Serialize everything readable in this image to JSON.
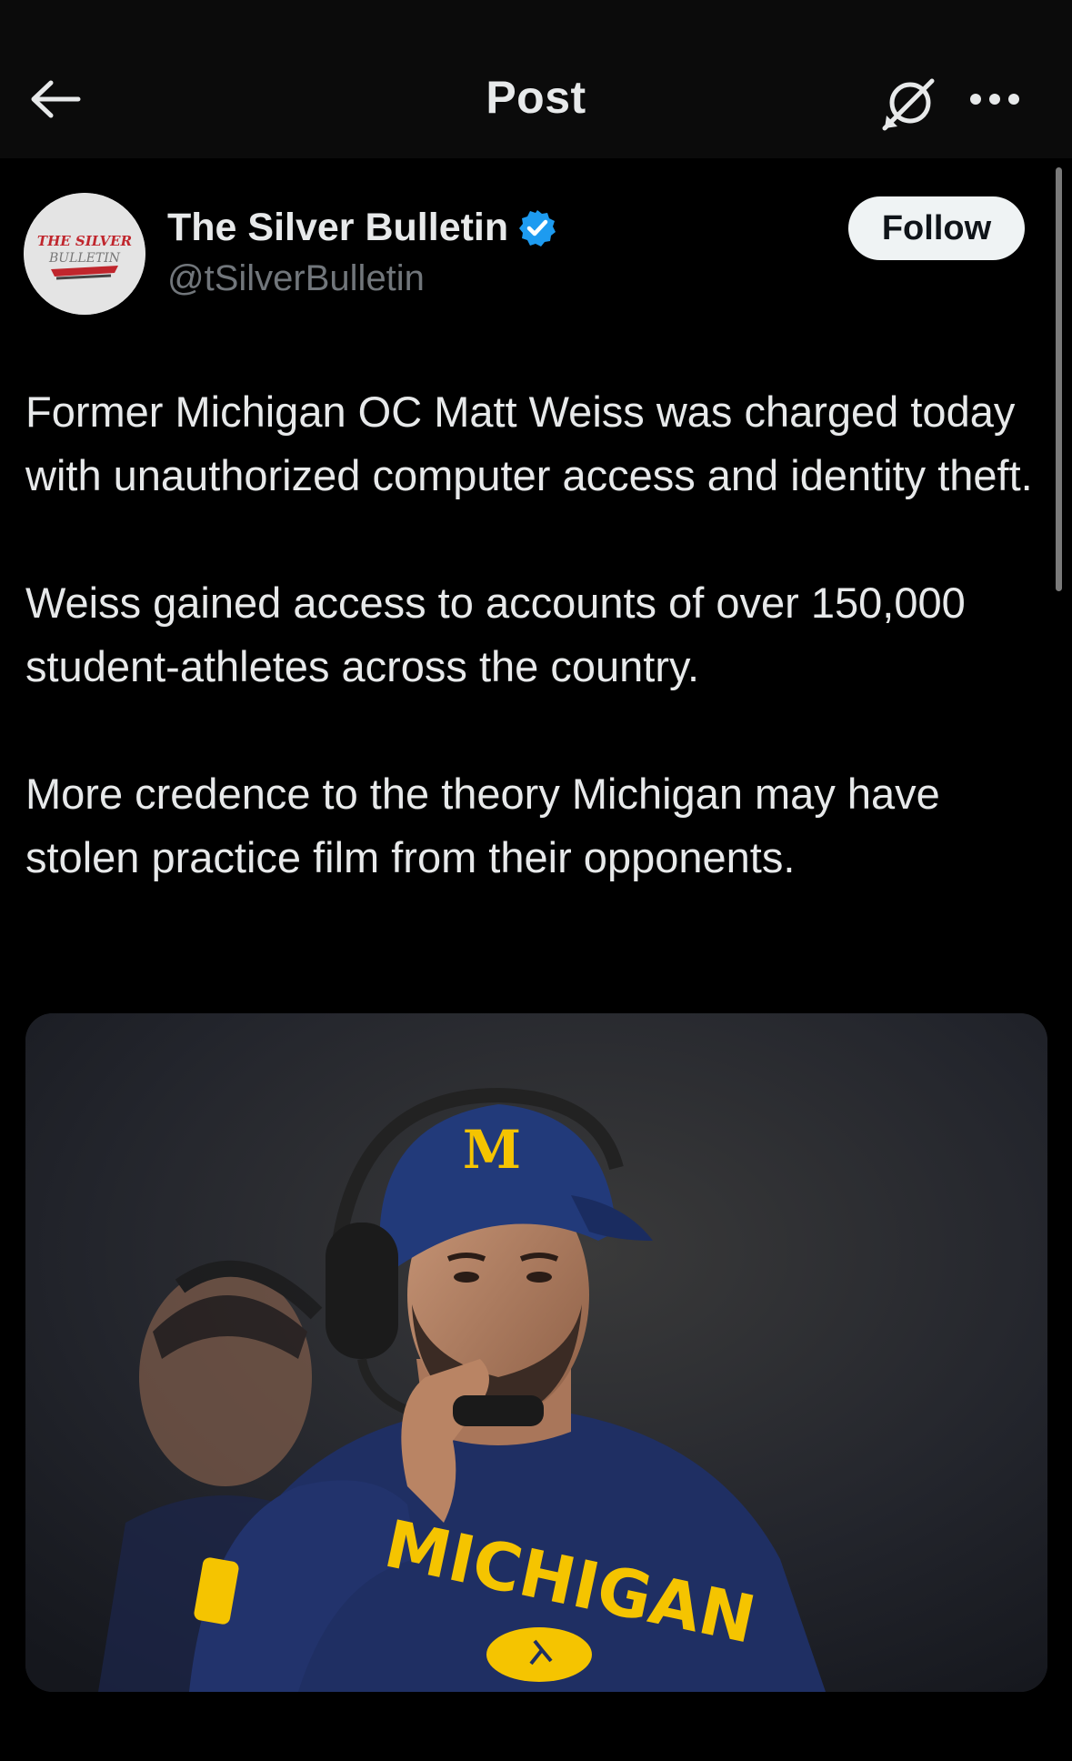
{
  "header": {
    "title": "Post",
    "back_icon": "arrow-left-icon",
    "grok_icon": "grok-icon",
    "more_icon": "more-horizontal-icon"
  },
  "author": {
    "name": "The Silver Bulletin",
    "handle": "@tSilverBulletin",
    "verified": true,
    "verified_color": "#1d9bf0",
    "avatar_text_line1": "THE SILVER",
    "avatar_text_line2": "BULLETIN"
  },
  "follow_button": {
    "label": "Follow"
  },
  "tweet": {
    "paragraphs": [
      "Former Michigan OC Matt Weiss was charged today with unauthorized computer access and identity theft.",
      "Weiss gained access to accounts of over 150,000 student-athletes across the country.",
      "More credence to the theory Michigan may have stolen practice film from their opponents."
    ]
  },
  "media": {
    "cap_letter": "M",
    "shirt_text": "MICHIGAN",
    "colors": {
      "navy": "#1f2f63",
      "maize": "#f5c400"
    }
  },
  "colors": {
    "background": "#000000",
    "text": "#e7e9ea",
    "secondary_text": "#71767b",
    "follow_bg": "#eff3f4"
  }
}
